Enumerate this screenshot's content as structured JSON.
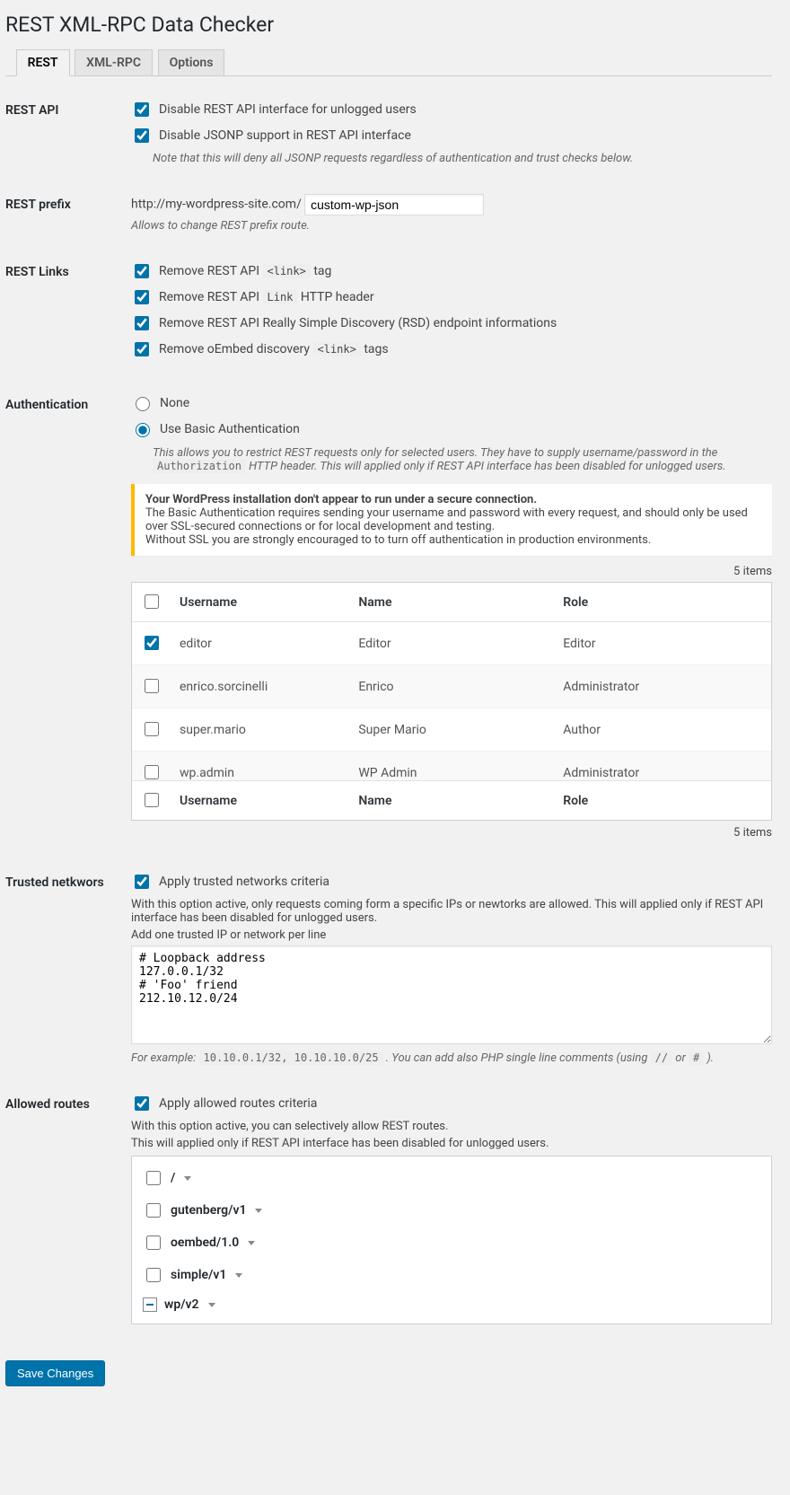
{
  "page_title": "REST XML-RPC Data Checker",
  "tabs": [
    {
      "label": "REST",
      "active": true
    },
    {
      "label": "XML-RPC",
      "active": false
    },
    {
      "label": "Options",
      "active": false
    }
  ],
  "sections": {
    "rest_api": {
      "heading": "REST API",
      "cb_disable_rest": {
        "checked": true,
        "label": "Disable REST API interface for unlogged users"
      },
      "cb_disable_jsonp": {
        "checked": true,
        "label": "Disable JSONP support in REST API interface"
      },
      "note": "Note that this will deny all JSONP requests regardless of authentication and trust checks below."
    },
    "rest_prefix": {
      "heading": "REST prefix",
      "base_url": "http://my-wordpress-site.com/",
      "value": "custom-wp-json",
      "desc": "Allows to change REST prefix route."
    },
    "rest_links": {
      "heading": "REST Links",
      "items": [
        {
          "checked": true,
          "pre": "Remove REST API ",
          "code": "<link>",
          "post": " tag"
        },
        {
          "checked": true,
          "pre": "Remove REST API ",
          "code": "Link",
          "post": " HTTP header"
        },
        {
          "checked": true,
          "pre": "Remove REST API Really Simple Discovery (RSD) endpoint informations",
          "code": "",
          "post": ""
        },
        {
          "checked": true,
          "pre": "Remove oEmbed discovery ",
          "code": "<link>",
          "post": " tags"
        }
      ]
    },
    "auth": {
      "heading": "Authentication",
      "radios": {
        "none": {
          "label": "None",
          "checked": false
        },
        "basic": {
          "label": "Use Basic Authentication",
          "checked": true
        }
      },
      "desc_pre": "This allows you to restrict REST requests only for selected users. They have to supply username/password in the ",
      "desc_code": "Authorization",
      "desc_post": " HTTP header. This will applied only if REST API interface has been disabled for unlogged users.",
      "warning": {
        "strong": "Your WordPress installation don't appear to run under a secure connection.",
        "l1": "The Basic Authentication requires sending your username and password with every request, and should only be used over SSL-secured connections or for local development and testing.",
        "l2": "Without SSL you are strongly encouraged to to turn off authentication in production environments."
      },
      "count": "5 items",
      "cols": {
        "user": "Username",
        "name": "Name",
        "role": "Role"
      },
      "rows": [
        {
          "checked": true,
          "username": "editor",
          "name": "Editor",
          "role": "Editor"
        },
        {
          "checked": false,
          "username": "enrico.sorcinelli",
          "name": "Enrico",
          "role": "Administrator"
        },
        {
          "checked": false,
          "username": "super.mario",
          "name": "Super Mario",
          "role": "Author"
        },
        {
          "checked": false,
          "username": "wp.admin",
          "name": "WP Admin",
          "role": "Administrator"
        }
      ]
    },
    "trusted": {
      "heading": "Trusted netkwors",
      "cb": {
        "checked": true,
        "label": "Apply trusted networks criteria"
      },
      "desc1": "With this option active, only requests coming form a specific IPs or newtorks are allowed. This will applied only if REST API interface has been disabled for unlogged users.",
      "desc2": "Add one trusted IP or network per line",
      "value": "# Loopback address\n127.0.0.1/32\n# 'Foo' friend\n212.10.12.0/24",
      "example_pre": "For example: ",
      "example_code": "10.10.0.1/32, 10.10.10.0/25",
      "example_mid": " . You can add also PHP single line comments (using ",
      "example_c1": "//",
      "example_mid2": " or ",
      "example_c2": "#",
      "example_post": " )."
    },
    "routes": {
      "heading": "Allowed routes",
      "cb": {
        "checked": true,
        "label": "Apply allowed routes criteria"
      },
      "desc1": "With this option active, you can selectively allow REST routes.",
      "desc2": "This will applied only if REST API interface has been disabled for unlogged users.",
      "items": [
        {
          "label": "/",
          "state": "unchecked"
        },
        {
          "label": "gutenberg/v1",
          "state": "unchecked"
        },
        {
          "label": "oembed/1.0",
          "state": "unchecked"
        },
        {
          "label": "simple/v1",
          "state": "unchecked"
        },
        {
          "label": "wp/v2",
          "state": "indeterminate"
        }
      ]
    }
  },
  "save_label": "Save Changes"
}
